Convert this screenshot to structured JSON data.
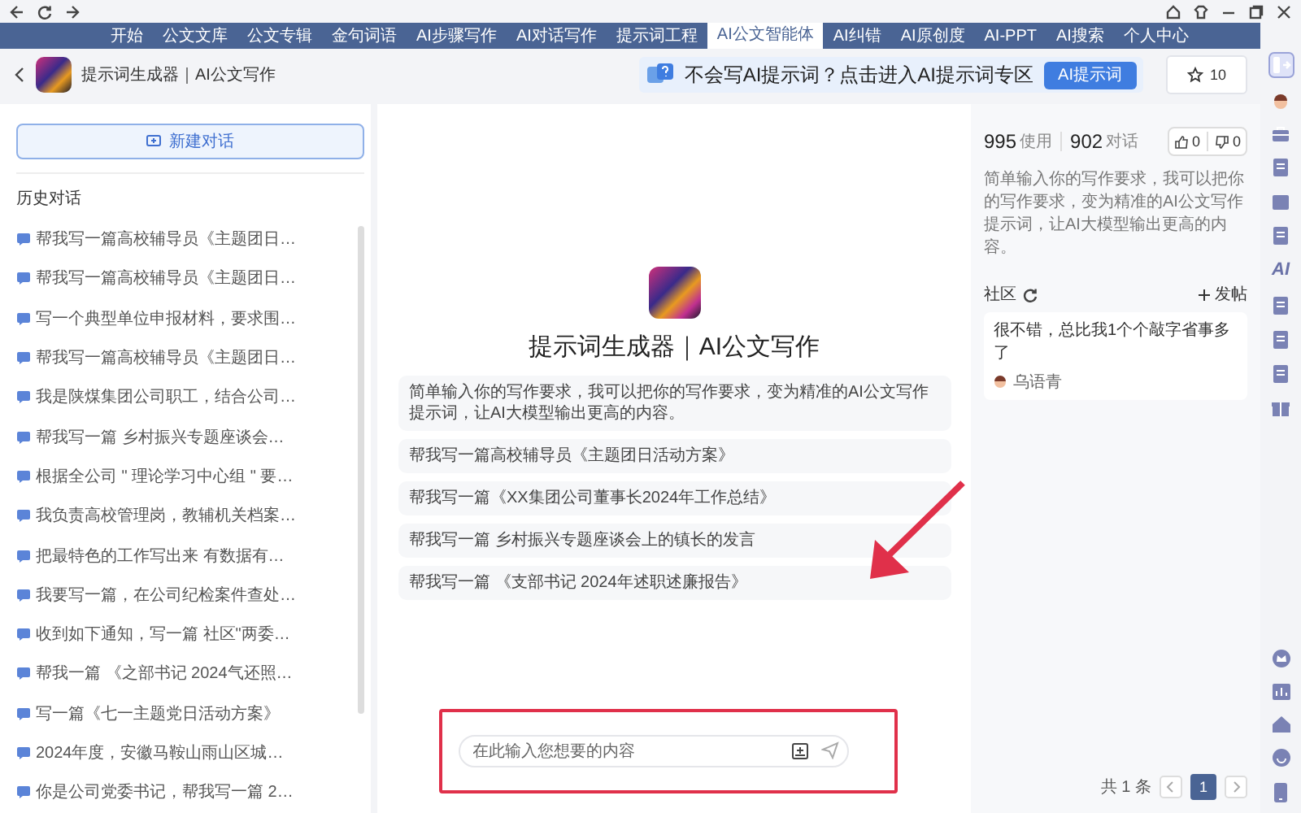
{
  "nav": {
    "tabs": [
      {
        "label": "开始",
        "selected": false
      },
      {
        "label": "公文文库",
        "selected": false
      },
      {
        "label": "公文专辑",
        "selected": false
      },
      {
        "label": "金句词语",
        "selected": false
      },
      {
        "label": "AI步骤写作",
        "selected": false
      },
      {
        "label": "AI对话写作",
        "selected": false
      },
      {
        "label": "提示词工程",
        "selected": false
      },
      {
        "label": "AI公文智能体",
        "selected": true
      },
      {
        "label": "AI纠错",
        "selected": false
      },
      {
        "label": "AI原创度",
        "selected": false
      },
      {
        "label": "AI-PPT",
        "selected": false
      },
      {
        "label": "AI搜索",
        "selected": false
      },
      {
        "label": "个人中心",
        "selected": false
      }
    ]
  },
  "header": {
    "title": "提示词生成器｜AI公文写作",
    "banner": "不会写AI提示词？点击进入AI提示词专区",
    "banner_button": "AI提示词",
    "favorites": "10"
  },
  "sidebar": {
    "new_chat": "新建对话",
    "history_title": "历史对话",
    "items": [
      "帮我写一篇高校辅导员《主题团日…",
      "帮我写一篇高校辅导员《主题团日…",
      "写一个典型单位申报材料，要求围…",
      "帮我写一篇高校辅导员《主题团日…",
      "我是陕煤集团公司职工，结合公司…",
      "帮我写一篇 乡村振兴专题座谈会…",
      "根据全公司 \" 理论学习中心组 \" 要…",
      "我负责高校管理岗，教辅机关档案…",
      "把最特色的工作写出来 有数据有…",
      "我要写一篇，在公司纪检案件查处…",
      "收到如下通知，写一篇 社区\"两委…",
      "帮我一篇 《之部书记 2024气还照…",
      "写一篇《七一主题党日活动方案》",
      "2024年度，安徽马鞍山雨山区城…",
      "你是公司党委书记，帮我写一篇 2…"
    ]
  },
  "agent": {
    "title": "提示词生成器｜AI公文写作",
    "intro": "简单输入你的写作要求，我可以把你的写作要求，变为精准的AI公文写作提示词，让AI大模型输出更高的内容。",
    "suggestions": [
      "帮我写一篇高校辅导员《主题团日活动方案》",
      "帮我写一篇《XX集团公司董事长2024年工作总结》",
      "帮我写一篇 乡村振兴专题座谈会上的镇长的发言",
      "帮我写一篇 《支部书记 2024年述职述廉报告》"
    ]
  },
  "composer": {
    "placeholder": "在此输入您想要的内容"
  },
  "info": {
    "uses": "995",
    "uses_label": "使用",
    "chats": "902",
    "chats_label": "对话",
    "likes": "0",
    "dislikes": "0",
    "description": "简单输入你的写作要求，我可以把你的写作要求，变为精准的AI公文写作提示词，让AI大模型输出更高的内容。",
    "community_title": "社区",
    "post_button": "发帖",
    "posts": [
      {
        "text": "很不错，总比我1个个敲字省事多了",
        "author": "乌语青"
      }
    ],
    "total": "共 1 条",
    "pages": [
      {
        "label": "1",
        "selected": true
      }
    ]
  },
  "rail": {
    "label": "AI"
  }
}
